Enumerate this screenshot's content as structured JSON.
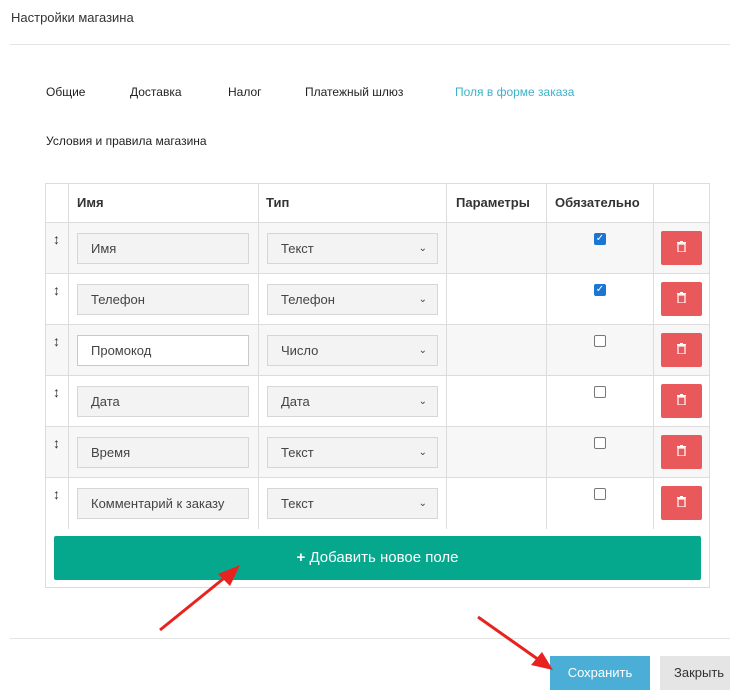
{
  "window": {
    "title": "Настройки магазина"
  },
  "tabs": [
    {
      "label": "Общие",
      "active": false
    },
    {
      "label": "Доставка",
      "active": false
    },
    {
      "label": "Налог",
      "active": false
    },
    {
      "label": "Платежный шлюз",
      "active": false
    },
    {
      "label": "Поля в форме заказа",
      "active": true
    },
    {
      "label": "Условия и правила магазина",
      "active": false
    }
  ],
  "table": {
    "headers": [
      "Имя",
      "Тип",
      "Параметры",
      "Обязательно"
    ],
    "rows": [
      {
        "name": "Имя",
        "type": "Текст",
        "required": true
      },
      {
        "name": "Телефон",
        "type": "Телефон",
        "required": true
      },
      {
        "name": "Промокод",
        "type": "Число",
        "required": false
      },
      {
        "name": "Дата",
        "type": "Дата",
        "required": false
      },
      {
        "name": "Время",
        "type": "Текст",
        "required": false
      },
      {
        "name": "Комментарий к заказу",
        "type": "Текст",
        "required": false
      }
    ]
  },
  "add_button": {
    "label": "Добавить новое поле",
    "icon": "plus-icon"
  },
  "footer": {
    "save_label": "Сохранить",
    "close_label": "Закрыть"
  },
  "colors": {
    "active_tab": "#3bb2c8",
    "add": "#05a88d",
    "delete": "#e9585a",
    "save": "#4aaed6",
    "arrow": "#e8231f"
  }
}
